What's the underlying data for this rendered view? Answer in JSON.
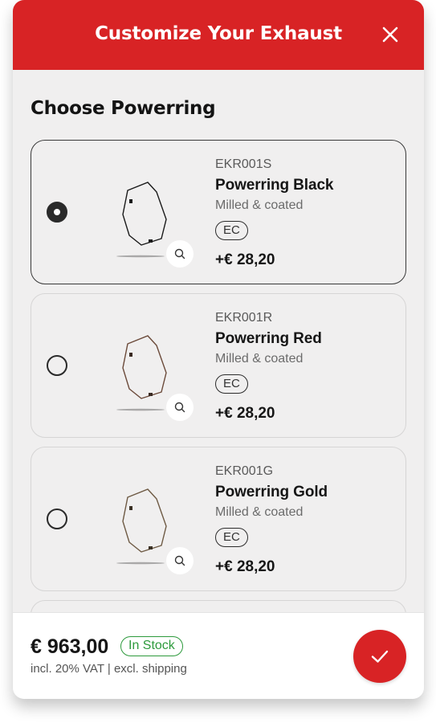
{
  "header": {
    "title": "Customize Your Exhaust",
    "close_icon": "close-icon"
  },
  "section": {
    "title": "Choose Powerring"
  },
  "options": [
    {
      "sku": "EKR001S",
      "name": "Powerring Black",
      "desc": "Milled & coated",
      "badge": "EC",
      "price": "+€ 28,20",
      "selected": true,
      "ring_color": "#1a1a1a"
    },
    {
      "sku": "EKR001R",
      "name": "Powerring Red",
      "desc": "Milled & coated",
      "badge": "EC",
      "price": "+€ 28,20",
      "selected": false,
      "ring_color": "#6b4a3a"
    },
    {
      "sku": "EKR001G",
      "name": "Powerring Gold",
      "desc": "Milled & coated",
      "badge": "EC",
      "price": "+€ 28,20",
      "selected": false,
      "ring_color": "#6e5a44"
    }
  ],
  "footer": {
    "total": "€ 963,00",
    "stock": "In Stock",
    "vat_note": "incl. 20% VAT | excl. shipping",
    "confirm_icon": "check-icon"
  },
  "colors": {
    "brand_red": "#d82325",
    "stock_green": "#2d9a3c"
  }
}
